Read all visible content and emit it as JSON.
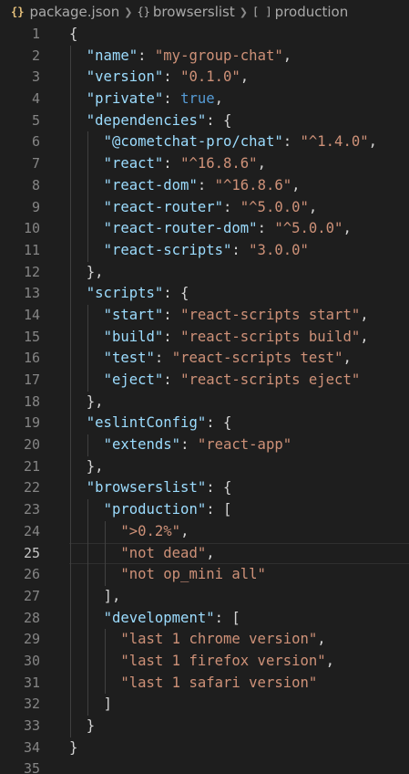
{
  "breadcrumb": {
    "file_icon": "{}",
    "file": "package.json",
    "obj_icon": "{}",
    "section": "browserslist",
    "arr_icon": "[ ]",
    "item": "production"
  },
  "code": {
    "current_line": 25,
    "lines": [
      {
        "n": "1",
        "depth": 0,
        "tokens": [
          [
            "p",
            "{"
          ]
        ]
      },
      {
        "n": "2",
        "depth": 1,
        "tokens": [
          [
            "k",
            "\"name\""
          ],
          [
            "p",
            ": "
          ],
          [
            "s",
            "\"my-group-chat\""
          ],
          [
            "p",
            ","
          ]
        ]
      },
      {
        "n": "3",
        "depth": 1,
        "tokens": [
          [
            "k",
            "\"version\""
          ],
          [
            "p",
            ": "
          ],
          [
            "s",
            "\"0.1.0\""
          ],
          [
            "p",
            ","
          ]
        ]
      },
      {
        "n": "4",
        "depth": 1,
        "tokens": [
          [
            "k",
            "\"private\""
          ],
          [
            "p",
            ": "
          ],
          [
            "b",
            "true"
          ],
          [
            "p",
            ","
          ]
        ]
      },
      {
        "n": "5",
        "depth": 1,
        "tokens": [
          [
            "k",
            "\"dependencies\""
          ],
          [
            "p",
            ": {"
          ]
        ]
      },
      {
        "n": "6",
        "depth": 2,
        "tokens": [
          [
            "k",
            "\"@cometchat-pro/chat\""
          ],
          [
            "p",
            ": "
          ],
          [
            "s",
            "\"^1.4.0\""
          ],
          [
            "p",
            ","
          ]
        ]
      },
      {
        "n": "7",
        "depth": 2,
        "tokens": [
          [
            "k",
            "\"react\""
          ],
          [
            "p",
            ": "
          ],
          [
            "s",
            "\"^16.8.6\""
          ],
          [
            "p",
            ","
          ]
        ]
      },
      {
        "n": "8",
        "depth": 2,
        "tokens": [
          [
            "k",
            "\"react-dom\""
          ],
          [
            "p",
            ": "
          ],
          [
            "s",
            "\"^16.8.6\""
          ],
          [
            "p",
            ","
          ]
        ]
      },
      {
        "n": "9",
        "depth": 2,
        "tokens": [
          [
            "k",
            "\"react-router\""
          ],
          [
            "p",
            ": "
          ],
          [
            "s",
            "\"^5.0.0\""
          ],
          [
            "p",
            ","
          ]
        ]
      },
      {
        "n": "10",
        "depth": 2,
        "tokens": [
          [
            "k",
            "\"react-router-dom\""
          ],
          [
            "p",
            ": "
          ],
          [
            "s",
            "\"^5.0.0\""
          ],
          [
            "p",
            ","
          ]
        ]
      },
      {
        "n": "11",
        "depth": 2,
        "tokens": [
          [
            "k",
            "\"react-scripts\""
          ],
          [
            "p",
            ": "
          ],
          [
            "s",
            "\"3.0.0\""
          ]
        ]
      },
      {
        "n": "12",
        "depth": 1,
        "tokens": [
          [
            "p",
            "},"
          ]
        ]
      },
      {
        "n": "13",
        "depth": 1,
        "tokens": [
          [
            "k",
            "\"scripts\""
          ],
          [
            "p",
            ": {"
          ]
        ]
      },
      {
        "n": "14",
        "depth": 2,
        "tokens": [
          [
            "k",
            "\"start\""
          ],
          [
            "p",
            ": "
          ],
          [
            "s",
            "\"react-scripts start\""
          ],
          [
            "p",
            ","
          ]
        ]
      },
      {
        "n": "15",
        "depth": 2,
        "tokens": [
          [
            "k",
            "\"build\""
          ],
          [
            "p",
            ": "
          ],
          [
            "s",
            "\"react-scripts build\""
          ],
          [
            "p",
            ","
          ]
        ]
      },
      {
        "n": "16",
        "depth": 2,
        "tokens": [
          [
            "k",
            "\"test\""
          ],
          [
            "p",
            ": "
          ],
          [
            "s",
            "\"react-scripts test\""
          ],
          [
            "p",
            ","
          ]
        ]
      },
      {
        "n": "17",
        "depth": 2,
        "tokens": [
          [
            "k",
            "\"eject\""
          ],
          [
            "p",
            ": "
          ],
          [
            "s",
            "\"react-scripts eject\""
          ]
        ]
      },
      {
        "n": "18",
        "depth": 1,
        "tokens": [
          [
            "p",
            "},"
          ]
        ]
      },
      {
        "n": "19",
        "depth": 1,
        "tokens": [
          [
            "k",
            "\"eslintConfig\""
          ],
          [
            "p",
            ": {"
          ]
        ]
      },
      {
        "n": "20",
        "depth": 2,
        "tokens": [
          [
            "k",
            "\"extends\""
          ],
          [
            "p",
            ": "
          ],
          [
            "s",
            "\"react-app\""
          ]
        ]
      },
      {
        "n": "21",
        "depth": 1,
        "tokens": [
          [
            "p",
            "},"
          ]
        ]
      },
      {
        "n": "22",
        "depth": 1,
        "tokens": [
          [
            "k",
            "\"browserslist\""
          ],
          [
            "p",
            ": {"
          ]
        ]
      },
      {
        "n": "23",
        "depth": 2,
        "tokens": [
          [
            "k",
            "\"production\""
          ],
          [
            "p",
            ": ["
          ]
        ]
      },
      {
        "n": "24",
        "depth": 3,
        "tokens": [
          [
            "s",
            "\">0.2%\""
          ],
          [
            "p",
            ","
          ]
        ]
      },
      {
        "n": "25",
        "depth": 3,
        "tokens": [
          [
            "s",
            "\"not dead\""
          ],
          [
            "p",
            ","
          ]
        ]
      },
      {
        "n": "26",
        "depth": 3,
        "tokens": [
          [
            "s",
            "\"not op_mini all\""
          ]
        ]
      },
      {
        "n": "27",
        "depth": 2,
        "tokens": [
          [
            "p",
            "],"
          ]
        ]
      },
      {
        "n": "28",
        "depth": 2,
        "tokens": [
          [
            "k",
            "\"development\""
          ],
          [
            "p",
            ": ["
          ]
        ]
      },
      {
        "n": "29",
        "depth": 3,
        "tokens": [
          [
            "s",
            "\"last 1 chrome version\""
          ],
          [
            "p",
            ","
          ]
        ]
      },
      {
        "n": "30",
        "depth": 3,
        "tokens": [
          [
            "s",
            "\"last 1 firefox version\""
          ],
          [
            "p",
            ","
          ]
        ]
      },
      {
        "n": "31",
        "depth": 3,
        "tokens": [
          [
            "s",
            "\"last 1 safari version\""
          ]
        ]
      },
      {
        "n": "32",
        "depth": 2,
        "tokens": [
          [
            "p",
            "]"
          ]
        ]
      },
      {
        "n": "33",
        "depth": 1,
        "tokens": [
          [
            "p",
            "}"
          ]
        ]
      },
      {
        "n": "34",
        "depth": 0,
        "tokens": [
          [
            "p",
            "}"
          ]
        ]
      },
      {
        "n": "35",
        "depth": 0,
        "tokens": []
      }
    ]
  }
}
